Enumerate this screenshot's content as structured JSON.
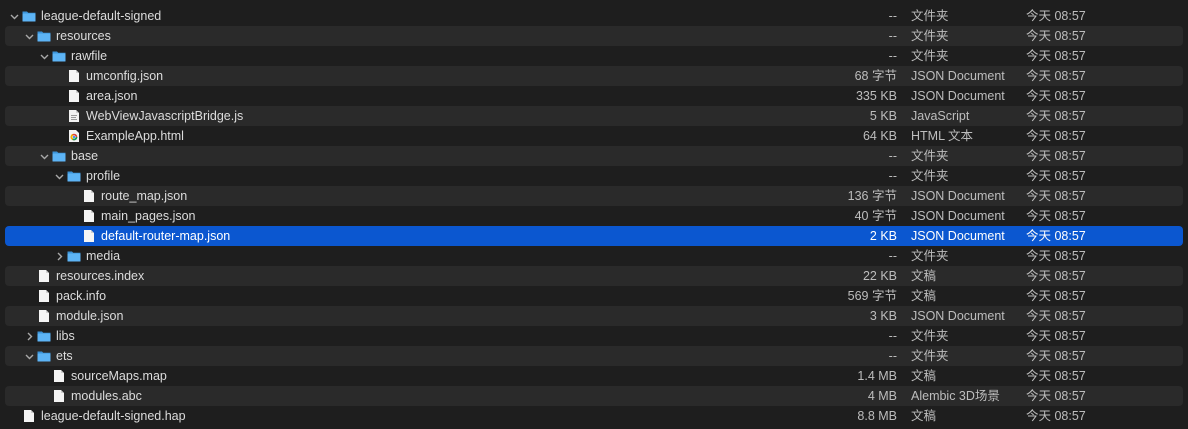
{
  "rows": [
    {
      "name": "league-default-signed",
      "size": "--",
      "kind": "文件夹",
      "date": "今天 08:57",
      "depth": 0,
      "type": "folder",
      "disclosure": "open"
    },
    {
      "name": "resources",
      "size": "--",
      "kind": "文件夹",
      "date": "今天 08:57",
      "depth": 1,
      "type": "folder",
      "disclosure": "open"
    },
    {
      "name": "rawfile",
      "size": "--",
      "kind": "文件夹",
      "date": "今天 08:57",
      "depth": 2,
      "type": "folder",
      "disclosure": "open"
    },
    {
      "name": "umconfig.json",
      "size": "68 字节",
      "kind": "JSON Document",
      "date": "今天 08:57",
      "depth": 3,
      "type": "file",
      "disclosure": "none"
    },
    {
      "name": "area.json",
      "size": "335 KB",
      "kind": "JSON Document",
      "date": "今天 08:57",
      "depth": 3,
      "type": "file",
      "disclosure": "none"
    },
    {
      "name": "WebViewJavascriptBridge.js",
      "size": "5 KB",
      "kind": "JavaScript",
      "date": "今天 08:57",
      "depth": 3,
      "type": "js",
      "disclosure": "none"
    },
    {
      "name": "ExampleApp.html",
      "size": "64 KB",
      "kind": "HTML 文本",
      "date": "今天 08:57",
      "depth": 3,
      "type": "html",
      "disclosure": "none"
    },
    {
      "name": "base",
      "size": "--",
      "kind": "文件夹",
      "date": "今天 08:57",
      "depth": 2,
      "type": "folder",
      "disclosure": "open"
    },
    {
      "name": "profile",
      "size": "--",
      "kind": "文件夹",
      "date": "今天 08:57",
      "depth": 3,
      "type": "folder",
      "disclosure": "open"
    },
    {
      "name": "route_map.json",
      "size": "136 字节",
      "kind": "JSON Document",
      "date": "今天 08:57",
      "depth": 4,
      "type": "file",
      "disclosure": "none"
    },
    {
      "name": "main_pages.json",
      "size": "40 字节",
      "kind": "JSON Document",
      "date": "今天 08:57",
      "depth": 4,
      "type": "file",
      "disclosure": "none"
    },
    {
      "name": "default-router-map.json",
      "size": "2 KB",
      "kind": "JSON Document",
      "date": "今天 08:57",
      "depth": 4,
      "type": "file",
      "disclosure": "none",
      "selected": true
    },
    {
      "name": "media",
      "size": "--",
      "kind": "文件夹",
      "date": "今天 08:57",
      "depth": 3,
      "type": "folder",
      "disclosure": "closed"
    },
    {
      "name": "resources.index",
      "size": "22 KB",
      "kind": "文稿",
      "date": "今天 08:57",
      "depth": 1,
      "type": "file",
      "disclosure": "none"
    },
    {
      "name": "pack.info",
      "size": "569 字节",
      "kind": "文稿",
      "date": "今天 08:57",
      "depth": 1,
      "type": "file",
      "disclosure": "none"
    },
    {
      "name": "module.json",
      "size": "3 KB",
      "kind": "JSON Document",
      "date": "今天 08:57",
      "depth": 1,
      "type": "file",
      "disclosure": "none"
    },
    {
      "name": "libs",
      "size": "--",
      "kind": "文件夹",
      "date": "今天 08:57",
      "depth": 1,
      "type": "folder",
      "disclosure": "closed"
    },
    {
      "name": "ets",
      "size": "--",
      "kind": "文件夹",
      "date": "今天 08:57",
      "depth": 1,
      "type": "folder",
      "disclosure": "open"
    },
    {
      "name": "sourceMaps.map",
      "size": "1.4 MB",
      "kind": "文稿",
      "date": "今天 08:57",
      "depth": 2,
      "type": "file",
      "disclosure": "none"
    },
    {
      "name": "modules.abc",
      "size": "4 MB",
      "kind": "Alembic 3D场景",
      "date": "今天 08:57",
      "depth": 2,
      "type": "abc",
      "disclosure": "none"
    },
    {
      "name": "league-default-signed.hap",
      "size": "8.8 MB",
      "kind": "文稿",
      "date": "今天 08:57",
      "depth": 0,
      "type": "file",
      "disclosure": "none"
    }
  ],
  "colors": {
    "selection": "#0b57d0",
    "folder": "#4aa8f0",
    "background": "#1e1e1e",
    "stripe": "#2a2a2a"
  }
}
